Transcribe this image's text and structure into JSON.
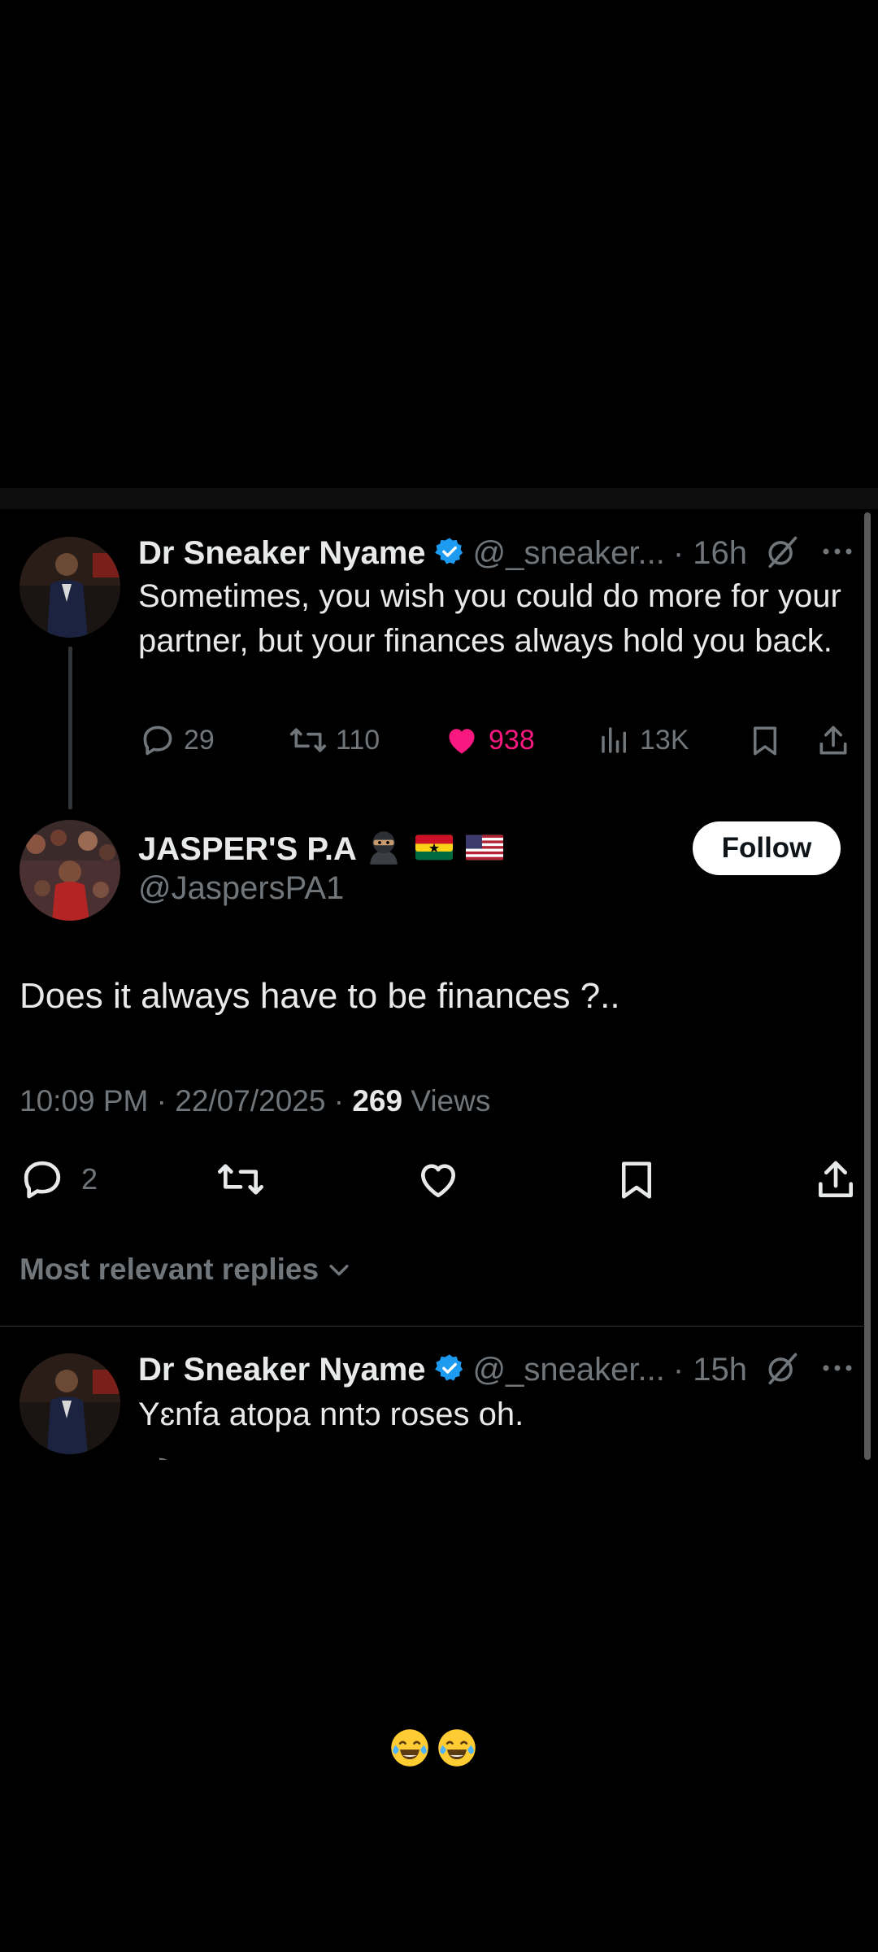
{
  "tweet_parent": {
    "author_name": "Dr Sneaker Nyame",
    "handle": "@_sneaker...",
    "time": "· 16h",
    "text": "Sometimes, you wish you could do more for your partner, but your finances always hold you back.",
    "stats": {
      "replies": "29",
      "reposts": "110",
      "likes": "938",
      "views": "13K"
    },
    "like_color": "#f91880"
  },
  "tweet_main": {
    "author_name": "JASPER'S P.A",
    "handle": "@JaspersPA1",
    "follow_label": "Follow",
    "text": "Does it always have to be finances ?..",
    "time": "10:09 PM · 22/07/2025 · ",
    "views_count": "269",
    "views_label": " Views",
    "reply_count": "2"
  },
  "replies_filter": {
    "label": "Most relevant replies"
  },
  "tweet_reply": {
    "author_name": "Dr Sneaker Nyame",
    "handle": "@_sneaker...",
    "time": "· 15h",
    "text": "Yɛnfa atopa nntɔ roses oh."
  },
  "caption": {
    "emoji": "😂😂"
  },
  "colors": {
    "verified": "#1d9bf0",
    "background": "#000000",
    "text": "#e7e9ea",
    "muted": "#71767b"
  }
}
